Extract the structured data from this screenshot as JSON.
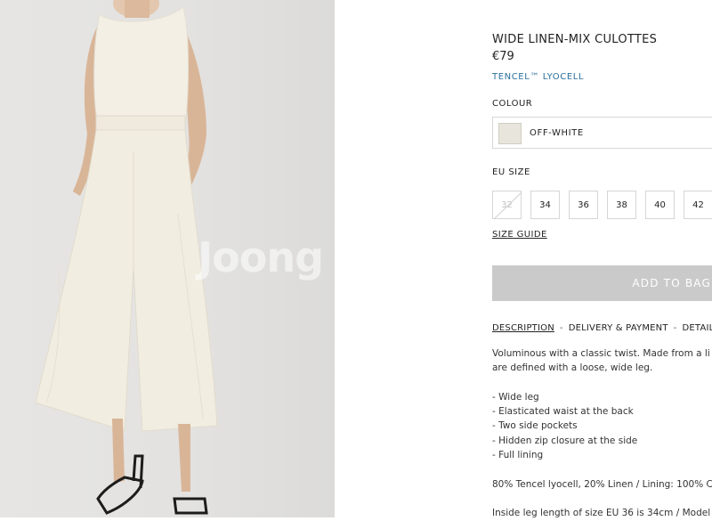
{
  "photo": {
    "alt": "Model wearing off-white wide linen-mix culottes",
    "watermark": "Joong"
  },
  "product": {
    "title": "WIDE LINEN-MIX CULOTTES",
    "price": "€79",
    "material": "TENCEL™ LYOCELL"
  },
  "colour": {
    "label": "COLOUR",
    "selected": "OFF-WHITE",
    "swatch_color": "#e8e6dc"
  },
  "sizes": {
    "label": "EU SIZE",
    "options": [
      {
        "value": "32",
        "available": false
      },
      {
        "value": "34",
        "available": true
      },
      {
        "value": "36",
        "available": true
      },
      {
        "value": "38",
        "available": true
      },
      {
        "value": "40",
        "available": true
      },
      {
        "value": "42",
        "available": true
      }
    ],
    "guide_label": "SIZE GUIDE"
  },
  "add_to_bag": "ADD TO BAG",
  "tabs": [
    {
      "label": "DESCRIPTION",
      "active": true
    },
    {
      "label": "DELIVERY & PAYMENT",
      "active": false
    },
    {
      "label": "DETAILS",
      "active": false
    }
  ],
  "tab_separator": "-",
  "description": {
    "intro_1": "Voluminous with a classic twist. Made from a li",
    "intro_2": "are defined with a loose, wide leg.",
    "bullets": [
      "- Wide leg",
      "- Elasticated waist at the back",
      "- Two side pockets",
      "- Hidden zip closure at the side",
      "- Full lining"
    ],
    "composition": "80% Tencel lyocell, 20% Linen / Lining: 100% C",
    "fit": "Inside leg length of size EU 36 is 34cm / Model"
  }
}
